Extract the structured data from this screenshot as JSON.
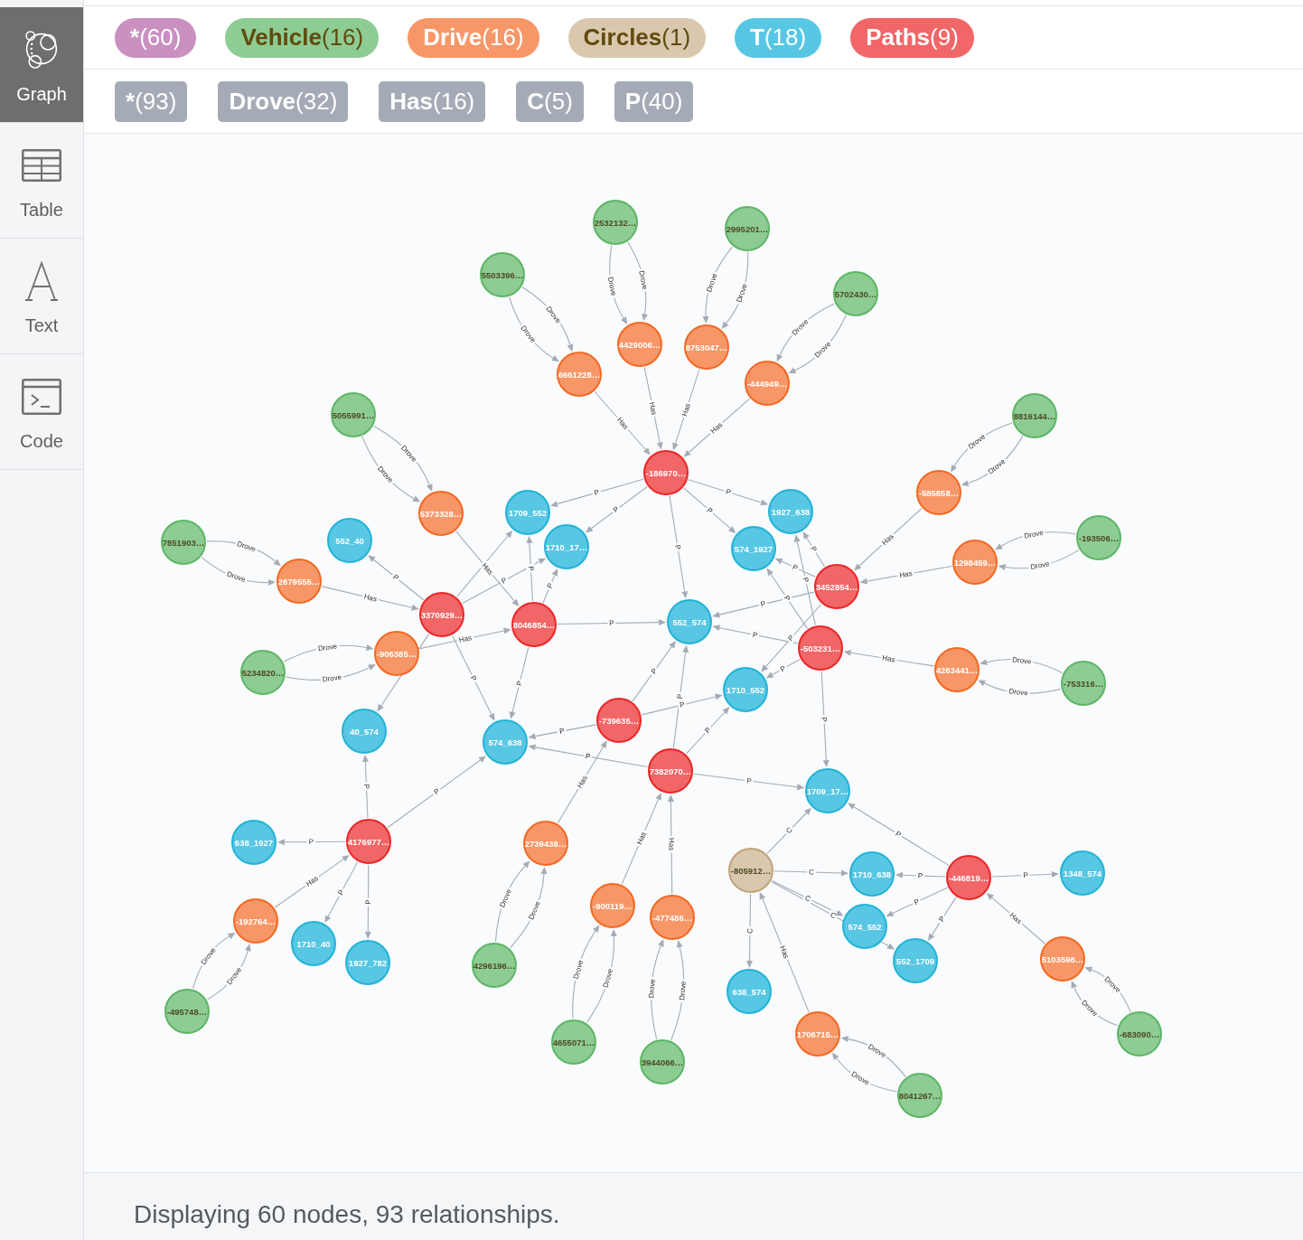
{
  "sidebar": {
    "items": [
      {
        "label": "Graph",
        "selected": true
      },
      {
        "label": "Table",
        "selected": false
      },
      {
        "label": "Text",
        "selected": false
      },
      {
        "label": "Code",
        "selected": false
      }
    ]
  },
  "node_labels": [
    {
      "name": "*",
      "count": "(60)",
      "kind": "all",
      "color": "#c990c0"
    },
    {
      "name": "Vehicle",
      "count": "(16)",
      "kind": "vehicle",
      "color": "#8dcc93"
    },
    {
      "name": "Drive",
      "count": "(16)",
      "kind": "drive",
      "color": "#f79767"
    },
    {
      "name": "Circles",
      "count": "(1)",
      "kind": "circles",
      "color": "#d9c8ae"
    },
    {
      "name": "T",
      "count": "(18)",
      "kind": "t",
      "color": "#57c7e3"
    },
    {
      "name": "Paths",
      "count": "(9)",
      "kind": "paths",
      "color": "#f16667"
    }
  ],
  "relationship_types": [
    {
      "name": "*",
      "count": "(93)"
    },
    {
      "name": "Drove",
      "count": "(32)"
    },
    {
      "name": "Has",
      "count": "(16)"
    },
    {
      "name": "C",
      "count": "(5)"
    },
    {
      "name": "P",
      "count": "(40)"
    }
  ],
  "graph": {
    "nodes": [
      {
        "label": "2532132…",
        "kind": "vehicle"
      },
      {
        "label": "2995201…",
        "kind": "vehicle"
      },
      {
        "label": "5503396…",
        "kind": "vehicle"
      },
      {
        "label": "5702430…",
        "kind": "vehicle"
      },
      {
        "label": "4429006…",
        "kind": "drive"
      },
      {
        "label": "8753047…",
        "kind": "drive"
      },
      {
        "label": "6661228…",
        "kind": "drive"
      },
      {
        "label": "-444949…",
        "kind": "drive"
      },
      {
        "label": "5055991…",
        "kind": "vehicle"
      },
      {
        "label": "8816144…",
        "kind": "vehicle"
      },
      {
        "label": "-186970…",
        "kind": "paths"
      },
      {
        "label": "-585858…",
        "kind": "drive"
      },
      {
        "label": "5373328…",
        "kind": "drive"
      },
      {
        "label": "1709_552",
        "kind": "t"
      },
      {
        "label": "1927_638",
        "kind": "t"
      },
      {
        "label": "7851903…",
        "kind": "vehicle"
      },
      {
        "label": "552_40",
        "kind": "t"
      },
      {
        "label": "1710_17…",
        "kind": "t"
      },
      {
        "label": "574_1927",
        "kind": "t"
      },
      {
        "label": "-193506…",
        "kind": "vehicle"
      },
      {
        "label": "1298459…",
        "kind": "drive"
      },
      {
        "label": "2679555…",
        "kind": "drive"
      },
      {
        "label": "3452854…",
        "kind": "paths"
      },
      {
        "label": "3370929…",
        "kind": "paths"
      },
      {
        "label": "8046854…",
        "kind": "paths"
      },
      {
        "label": "552_574",
        "kind": "t"
      },
      {
        "label": "-906385…",
        "kind": "drive"
      },
      {
        "label": "-503231…",
        "kind": "paths"
      },
      {
        "label": "5234820…",
        "kind": "vehicle"
      },
      {
        "label": "4263441…",
        "kind": "drive"
      },
      {
        "label": "1710_552",
        "kind": "t"
      },
      {
        "label": "-753316…",
        "kind": "vehicle"
      },
      {
        "label": "-739635…",
        "kind": "paths"
      },
      {
        "label": "40_574",
        "kind": "t"
      },
      {
        "label": "574_638",
        "kind": "t"
      },
      {
        "label": "7382070…",
        "kind": "paths"
      },
      {
        "label": "1709_17…",
        "kind": "t"
      },
      {
        "label": "638_1927",
        "kind": "t"
      },
      {
        "label": "4176977…",
        "kind": "paths"
      },
      {
        "label": "2739438…",
        "kind": "drive"
      },
      {
        "label": "-805912…",
        "kind": "circles"
      },
      {
        "label": "1710_638",
        "kind": "t"
      },
      {
        "label": "-446819…",
        "kind": "paths"
      },
      {
        "label": "1348_574",
        "kind": "t"
      },
      {
        "label": "-900119…",
        "kind": "drive"
      },
      {
        "label": "-192764…",
        "kind": "drive"
      },
      {
        "label": "-477486…",
        "kind": "drive"
      },
      {
        "label": "574_552",
        "kind": "t"
      },
      {
        "label": "1710_40",
        "kind": "t"
      },
      {
        "label": "1927_782",
        "kind": "t"
      },
      {
        "label": "4296196…",
        "kind": "vehicle"
      },
      {
        "label": "552_1709",
        "kind": "t"
      },
      {
        "label": "5103596…",
        "kind": "drive"
      },
      {
        "label": "638_574",
        "kind": "t"
      },
      {
        "label": "-495748…",
        "kind": "vehicle"
      },
      {
        "label": "4655071…",
        "kind": "vehicle"
      },
      {
        "label": "1706715…",
        "kind": "drive"
      },
      {
        "label": "-683090…",
        "kind": "vehicle"
      },
      {
        "label": "3944066…",
        "kind": "vehicle"
      },
      {
        "label": "8041267…",
        "kind": "vehicle"
      }
    ],
    "relationships": [
      {
        "label": "Drove"
      },
      {
        "label": "Drove"
      },
      {
        "label": "Drove"
      },
      {
        "label": "Drove"
      },
      {
        "label": "Drove"
      },
      {
        "label": "Drove"
      },
      {
        "label": "Drove"
      },
      {
        "label": "Drove"
      },
      {
        "label": "Drove"
      },
      {
        "label": "Drove"
      },
      {
        "label": "Drove"
      },
      {
        "label": "Drove"
      },
      {
        "label": "Drove"
      },
      {
        "label": "Drove"
      },
      {
        "label": "Drove"
      },
      {
        "label": "Drove"
      },
      {
        "label": "Drove"
      },
      {
        "label": "Drove"
      },
      {
        "label": "Drove"
      },
      {
        "label": "Drove"
      },
      {
        "label": "Drove"
      },
      {
        "label": "Drove"
      },
      {
        "label": "Drove"
      },
      {
        "label": "Drove"
      },
      {
        "label": "Drove"
      },
      {
        "label": "Drove"
      },
      {
        "label": "Drove"
      },
      {
        "label": "Drove"
      },
      {
        "label": "Drove"
      },
      {
        "label": "Drove"
      },
      {
        "label": "Drove"
      },
      {
        "label": "Drove"
      },
      {
        "label": "Has"
      },
      {
        "label": "Has"
      },
      {
        "label": "Has"
      },
      {
        "label": "Has"
      },
      {
        "label": "Has"
      },
      {
        "label": "Has"
      },
      {
        "label": "Has"
      },
      {
        "label": "Has"
      },
      {
        "label": "Has"
      },
      {
        "label": "Has"
      },
      {
        "label": "Has"
      },
      {
        "label": "Has"
      },
      {
        "label": "Has"
      },
      {
        "label": "Has"
      },
      {
        "label": "Has"
      },
      {
        "label": "Has"
      },
      {
        "label": "C"
      },
      {
        "label": "C"
      },
      {
        "label": "C"
      },
      {
        "label": "C"
      },
      {
        "label": "C"
      },
      {
        "label": "P"
      },
      {
        "label": "P"
      },
      {
        "label": "P"
      },
      {
        "label": "P"
      },
      {
        "label": "P"
      },
      {
        "label": "P"
      },
      {
        "label": "P"
      },
      {
        "label": "P"
      },
      {
        "label": "P"
      },
      {
        "label": "P"
      },
      {
        "label": "P"
      },
      {
        "label": "P"
      },
      {
        "label": "P"
      },
      {
        "label": "P"
      },
      {
        "label": "P"
      },
      {
        "label": "P"
      },
      {
        "label": "P"
      },
      {
        "label": "P"
      },
      {
        "label": "P"
      },
      {
        "label": "P"
      },
      {
        "label": "P"
      },
      {
        "label": "P"
      },
      {
        "label": "P"
      },
      {
        "label": "P"
      },
      {
        "label": "P"
      },
      {
        "label": "P"
      },
      {
        "label": "P"
      },
      {
        "label": "P"
      },
      {
        "label": "P"
      },
      {
        "label": "P"
      },
      {
        "label": "P"
      },
      {
        "label": "P"
      },
      {
        "label": "P"
      },
      {
        "label": "P"
      },
      {
        "label": "P"
      },
      {
        "label": "P"
      },
      {
        "label": "P"
      },
      {
        "label": "P"
      }
    ]
  },
  "status_bar": {
    "message": "Displaying 60 nodes, 93 relationships."
  }
}
